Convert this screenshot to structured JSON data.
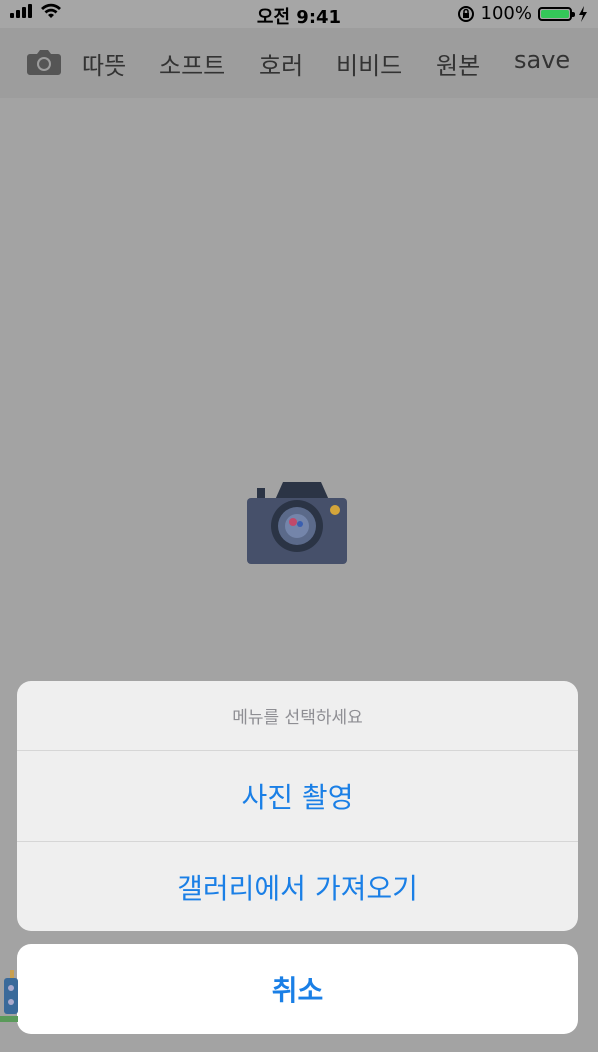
{
  "status_bar": {
    "time": "오전 9:41",
    "battery_percent": "100%",
    "icons": [
      "signal-icon",
      "wifi-icon",
      "orientation-lock-icon",
      "battery-icon",
      "charging-icon"
    ]
  },
  "toolbar": {
    "camera_icon": "camera-icon",
    "filters": [
      "따뜻",
      "소프트",
      "호러",
      "비비드",
      "원본"
    ],
    "save_label": "save"
  },
  "main": {
    "placeholder_icon": "camera-icon"
  },
  "action_sheet": {
    "title": "메뉴를 선택하세요",
    "actions": [
      "사진 촬영",
      "갤러리에서 가져오기"
    ],
    "cancel_label": "취소"
  },
  "colors": {
    "accent": "#1a7fe6",
    "overlay": "#a3a3a3",
    "battery": "#34c759"
  }
}
